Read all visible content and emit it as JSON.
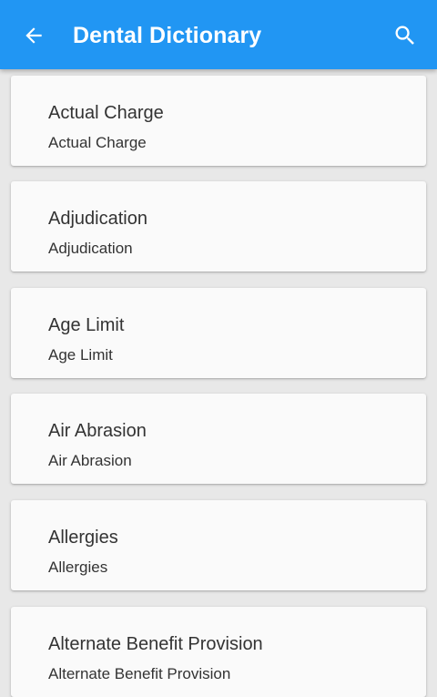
{
  "app_bar": {
    "title": "Dental Dictionary",
    "back_icon": "arrow-back-icon",
    "search_icon": "search-icon",
    "color": "#2196f3"
  },
  "terms": [
    {
      "term": "Actual Charge",
      "definition": "Actual Charge"
    },
    {
      "term": "Adjudication",
      "definition": "Adjudication"
    },
    {
      "term": "Age Limit",
      "definition": "Age Limit"
    },
    {
      "term": "Air Abrasion",
      "definition": "Air Abrasion"
    },
    {
      "term": "Allergies",
      "definition": "Allergies"
    },
    {
      "term": "Alternate Benefit Provision",
      "definition": "Alternate Benefit Provision"
    }
  ]
}
